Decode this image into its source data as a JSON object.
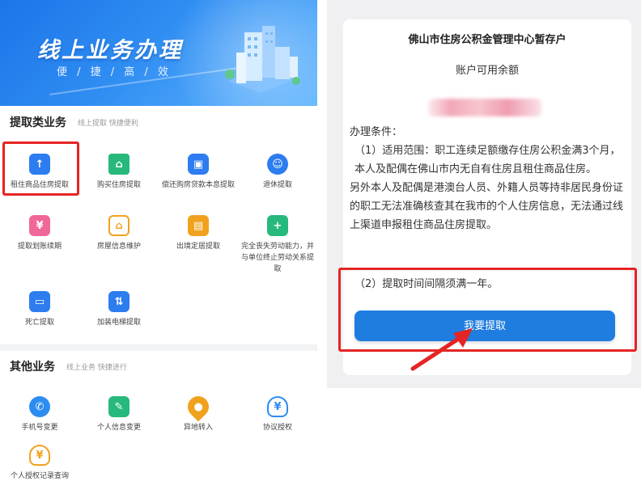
{
  "left": {
    "banner": {
      "title": "线上业务办理",
      "subtitle": "便 / 捷 / 高 / 效"
    },
    "withdraw_section": {
      "title": "提取类业务",
      "subtitle": "线上提取 快捷便利",
      "items": [
        {
          "label": "租住商品住房提取",
          "icon": "upload-tray-icon",
          "color": "#2d7cf0"
        },
        {
          "label": "购买住房提取",
          "icon": "house-up-arrow-icon",
          "color": "#27b97c"
        },
        {
          "label": "偿还购房贷款本息提取",
          "icon": "wallet-icon",
          "color": "#2d7cf0"
        },
        {
          "label": "退休提取",
          "icon": "retiree-icon",
          "color": "#2d7cf0"
        },
        {
          "label": "提取划账续期",
          "icon": "yuan-card-icon",
          "color": "#f0679a"
        },
        {
          "label": "房屋信息维护",
          "icon": "house-outline-icon",
          "color": "#f0a21e"
        },
        {
          "label": "出境定居提取",
          "icon": "passport-icon",
          "color": "#f0a21e"
        },
        {
          "label": "完全丧失劳动能力，并与单位终止劳动关系提取",
          "icon": "medical-doc-icon",
          "color": "#27b97c"
        },
        {
          "label": "死亡提取",
          "icon": "document-icon",
          "color": "#2d7cf0"
        },
        {
          "label": "加装电梯提取",
          "icon": "elevator-icon",
          "color": "#2d7cf0"
        }
      ]
    },
    "other_section": {
      "title": "其他业务",
      "subtitle": "线上业务 快捷进行",
      "items": [
        {
          "label": "手机号变更",
          "icon": "phone-icon",
          "color": "#2d8cf0"
        },
        {
          "label": "个人信息变更",
          "icon": "edit-icon",
          "color": "#27b97c"
        },
        {
          "label": "异地转入",
          "icon": "location-pin-icon",
          "color": "#f0a21e"
        },
        {
          "label": "协议授权",
          "icon": "money-bag-icon",
          "color": "#2d8cf0"
        },
        {
          "label": "个人授权记录查询",
          "icon": "yuan-bag-icon",
          "color": "#f0a21e"
        }
      ]
    }
  },
  "right": {
    "card_title": "佛山市住房公积金管理中心暂存户",
    "balance_label": "账户可用余额",
    "conditions_title": "办理条件：",
    "condition_1": "（1）适用范围：职工连续足额缴存住房公积金满3个月，本人及配偶在佛山市内无自有住房且租住商品住房。",
    "condition_1b": "另外本人及配偶是港澳台人员、外籍人员等持非居民身份证的职工无法准确核查其在我市的个人住房信息，无法通过线上渠道申报租住商品住房提取。",
    "condition_2": "（2）提取时间间隔须满一年。",
    "submit_label": "我要提取"
  },
  "colors": {
    "primary": "#1f7de0",
    "highlight": "#e52424"
  }
}
